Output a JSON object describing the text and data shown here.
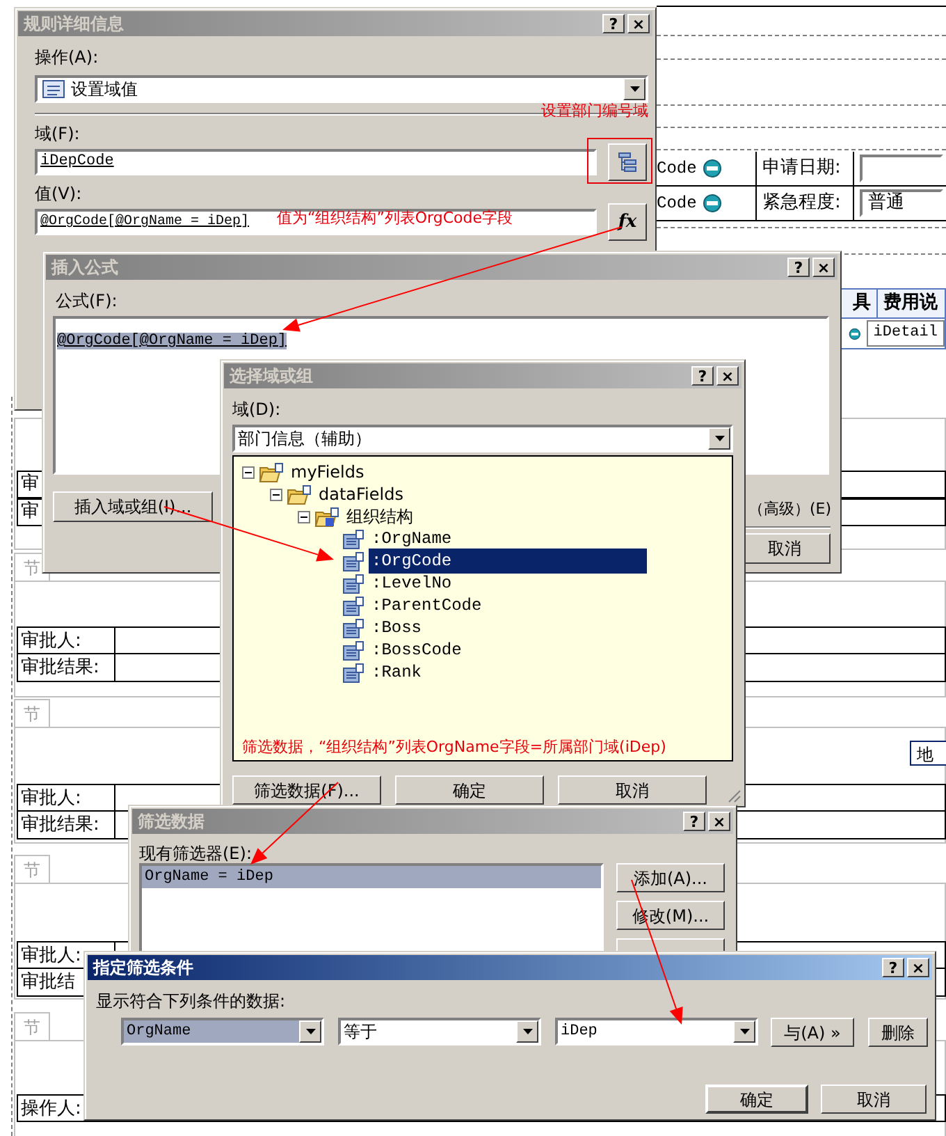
{
  "form_background": {
    "header_rows": [
      {
        "code": "Code",
        "label": "申请日期:"
      },
      {
        "code": "Code",
        "label": "紧急程度:",
        "value": "普通"
      }
    ],
    "detail_columns": [
      "具",
      "费用说"
    ],
    "detail_cell": "iDetail",
    "cut_labels": [
      "审",
      "审"
    ],
    "section_tabs": [
      "节",
      "节",
      "节",
      "节"
    ],
    "approval_tables": [
      {
        "approver": "审批人:",
        "result": "审批结果:"
      },
      {
        "approver": "审批人:",
        "result": "审批结果:"
      },
      {
        "approver": "审批人:",
        "result": "审批结"
      }
    ],
    "operator": "操作人:",
    "region_button": "地"
  },
  "rule_details": {
    "title": "规则详细信息",
    "active": false,
    "title_buttons": [
      "?",
      "×"
    ],
    "action_label": "操作(A):",
    "action_value": "设置域值",
    "field_label": "域(F):",
    "field_value": "iDepCode",
    "value_label": "值(V):",
    "value_value": "@OrgCode[@OrgName = iDep]",
    "formula_button": "fx",
    "annotations": [
      "设置部门编号域",
      "值为“组织结构”列表OrgCode字段"
    ]
  },
  "insert_formula": {
    "title": "插入公式",
    "active": false,
    "title_buttons": [
      "?",
      "×"
    ],
    "formula_label": "公式(F):",
    "formula": "@OrgCode[@OrgName = iDep]",
    "insert_button": "插入域或组(I)...",
    "advanced_label": "（高级）(E)",
    "cancel_button": "取消"
  },
  "select_field": {
    "title": "选择域或组",
    "active": false,
    "title_buttons": [
      "?",
      "×"
    ],
    "data_source_label": "域(D):",
    "data_source": "部门信息（辅助）",
    "tree": [
      {
        "label": "myFields",
        "kind": "group",
        "expanded": true,
        "selected": false,
        "children": [
          {
            "label": "dataFields",
            "kind": "group",
            "expanded": true,
            "selected": false,
            "children": [
              {
                "label": "组织结构",
                "kind": "repeating",
                "expanded": true,
                "selected": false,
                "children": [
                  {
                    "label": ":OrgName",
                    "kind": "field",
                    "selected": false
                  },
                  {
                    "label": ":OrgCode",
                    "kind": "field",
                    "selected": true
                  },
                  {
                    "label": ":LevelNo",
                    "kind": "field",
                    "selected": false
                  },
                  {
                    "label": ":ParentCode",
                    "kind": "field",
                    "selected": false
                  },
                  {
                    "label": ":Boss",
                    "kind": "field",
                    "selected": false
                  },
                  {
                    "label": ":BossCode",
                    "kind": "field",
                    "selected": false
                  },
                  {
                    "label": ":Rank",
                    "kind": "field",
                    "selected": false
                  }
                ]
              }
            ]
          }
        ]
      }
    ],
    "annotation": "筛选数据，“组织结构”列表OrgName字段=所属部门域(iDep)",
    "buttons": [
      "筛选数据(F)...",
      "确定",
      "取消"
    ]
  },
  "filter_data": {
    "title": "筛选数据",
    "active": false,
    "title_buttons": [
      "?",
      "×"
    ],
    "list_label": "现有筛选器(E):",
    "filters": [
      {
        "text": "OrgName = iDep",
        "selected": true
      }
    ],
    "buttons": [
      "添加(A)...",
      "修改(M)..."
    ]
  },
  "filter_condition": {
    "title": "指定筛选条件",
    "active": true,
    "title_buttons": [
      "?",
      "×"
    ],
    "label": "显示符合下列条件的数据:",
    "field": "OrgName",
    "operator": "等于",
    "value": "iDep",
    "and_button": "与(A) »",
    "delete_button": "删除",
    "buttons": [
      "确定",
      "取消"
    ]
  }
}
